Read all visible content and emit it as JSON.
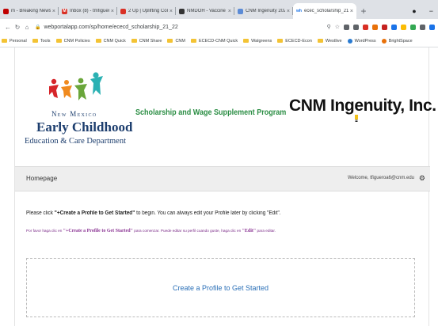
{
  "browser": {
    "tabs": [
      {
        "title": "m - Breaking News",
        "fav_color": "#c00000",
        "fav_glyph": "",
        "active": false
      },
      {
        "title": "Inbox (8) - tmfigueroa@gm",
        "fav_color": "#d93025",
        "fav_glyph": "M",
        "active": false
      },
      {
        "title": "2 Up | Uplifting Contempo",
        "fav_color": "#d93025",
        "fav_glyph": "",
        "active": false
      },
      {
        "title": "NMDOH - Vaccine Registr",
        "fav_color": "#333333",
        "fav_glyph": "",
        "active": false
      },
      {
        "title": "CNM Ingenuity 2021 - Zenc",
        "fav_color": "#5b8bd6",
        "fav_glyph": "",
        "active": false
      },
      {
        "title": "ecec_scholarship_21_22",
        "fav_color": "#ffffff",
        "fav_glyph": "wh",
        "active": true
      }
    ],
    "new_tab": "+",
    "window_controls": [
      "●",
      "−"
    ],
    "url": "webportalapp.com/sp/home/ececd_scholarship_21_22",
    "ext_colors": [
      "#5f6368",
      "#5f6368",
      "#d93025",
      "#e8710a",
      "#c5221f",
      "#1a73e8",
      "#fbbc04",
      "#34a853",
      "#5f6368",
      "#1a73e8"
    ],
    "bookmarks": [
      {
        "label": "Personal",
        "kind": "folder"
      },
      {
        "label": "Tools",
        "kind": "folder"
      },
      {
        "label": "CNM Policies",
        "kind": "folder"
      },
      {
        "label": "CNM Quick",
        "kind": "folder"
      },
      {
        "label": "CNM Share",
        "kind": "folder"
      },
      {
        "label": "CNM",
        "kind": "folder"
      },
      {
        "label": "ECECD-CNM Quick",
        "kind": "folder"
      },
      {
        "label": "Walgreens",
        "kind": "folder"
      },
      {
        "label": "ECECD-Econ",
        "kind": "folder"
      },
      {
        "label": "Westlive",
        "kind": "folder"
      },
      {
        "label": "WordPress",
        "kind": "dot",
        "color": "#2a7bd1"
      },
      {
        "label": "BrightSpace",
        "kind": "dot",
        "color": "#e8710a"
      }
    ]
  },
  "header": {
    "nm_line1": "New Mexico",
    "nm_line2": "Early Childhood",
    "nm_line3": "Education & Care Department",
    "program": "Scholarship and Wage Supplement Program",
    "company": "CNM Ingenuity, Inc."
  },
  "nav": {
    "home": "Homepage",
    "welcome": "Welcome, tfigueroa6@cnm.edu"
  },
  "body": {
    "instr_en_prefix": "Please click ",
    "instr_en_bold": "\"+Create a Profile to Get Started\"",
    "instr_en_suffix": " to begin. You can always edit your Profile later by clicking \"Edit\".",
    "instr_es_prefix": "Por favor haga clic en ",
    "instr_es_bold": "\"+Create a Profile to Get Started\"",
    "instr_es_middle": " para comenzar. Puede editar su perfil cuando guste, haga clic en ",
    "instr_es_bold2": "\"Edit\"",
    "instr_es_suffix": " para editar.",
    "create_label": "Create a Profile to Get Started"
  }
}
